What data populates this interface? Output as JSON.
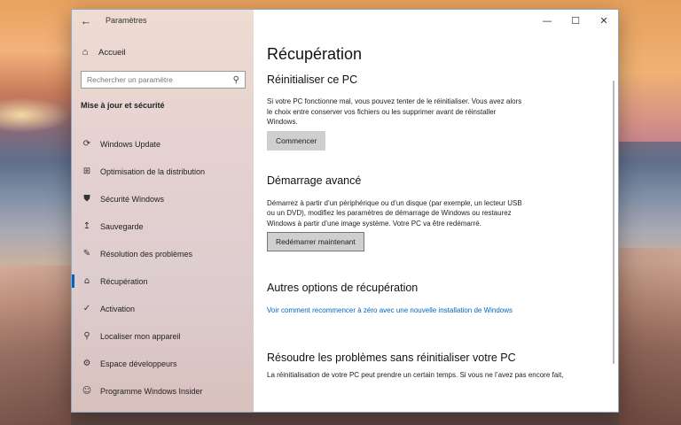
{
  "window": {
    "app_title": "Paramètres",
    "back_icon": "←",
    "minimize_icon": "—",
    "maximize_icon": "☐",
    "close_icon": "✕"
  },
  "sidebar": {
    "home_label": "Accueil",
    "home_icon": "⌂",
    "search": {
      "placeholder": "Rechercher un paramètre",
      "icon": "⚲"
    },
    "section_heading": "Mise à jour et sécurité",
    "items": [
      {
        "label": "Windows Update",
        "icon": "⟳"
      },
      {
        "label": "Optimisation de la distribution",
        "icon": "⊞"
      },
      {
        "label": "Sécurité Windows",
        "icon": "⛊"
      },
      {
        "label": "Sauvegarde",
        "icon": "↥"
      },
      {
        "label": "Résolution des problèmes",
        "icon": "✎"
      },
      {
        "label": "Récupération",
        "icon": "⌂",
        "active": true
      },
      {
        "label": "Activation",
        "icon": "✓"
      },
      {
        "label": "Localiser mon appareil",
        "icon": "⚲"
      },
      {
        "label": "Espace développeurs",
        "icon": "⚙"
      },
      {
        "label": "Programme Windows Insider",
        "icon": "☺"
      }
    ]
  },
  "main": {
    "title": "Récupération",
    "reset": {
      "heading": "Réinitialiser ce PC",
      "description": "Si votre PC fonctionne mal, vous pouvez tenter de le réinitialiser. Vous avez alors le choix entre conserver vos fichiers ou les supprimer avant de réinstaller Windows.",
      "button": "Commencer"
    },
    "advanced": {
      "heading": "Démarrage avancé",
      "description": "Démarrez à partir d’un périphérique ou d’un disque (par exemple, un lecteur USB ou un DVD), modifiez les paramètres de démarrage de Windows ou restaurez Windows à partir d’une image système. Votre PC va être redémarré.",
      "button": "Redémarrer maintenant"
    },
    "other": {
      "heading": "Autres options de récupération",
      "link": "Voir comment recommencer à zéro avec une nouvelle installation de Windows"
    },
    "troubleshoot": {
      "heading": "Résoudre les problèmes sans réinitialiser votre PC",
      "description": "La réinitialisation de votre PC peut prendre un certain temps. Si vous ne l’avez pas encore fait,"
    }
  }
}
